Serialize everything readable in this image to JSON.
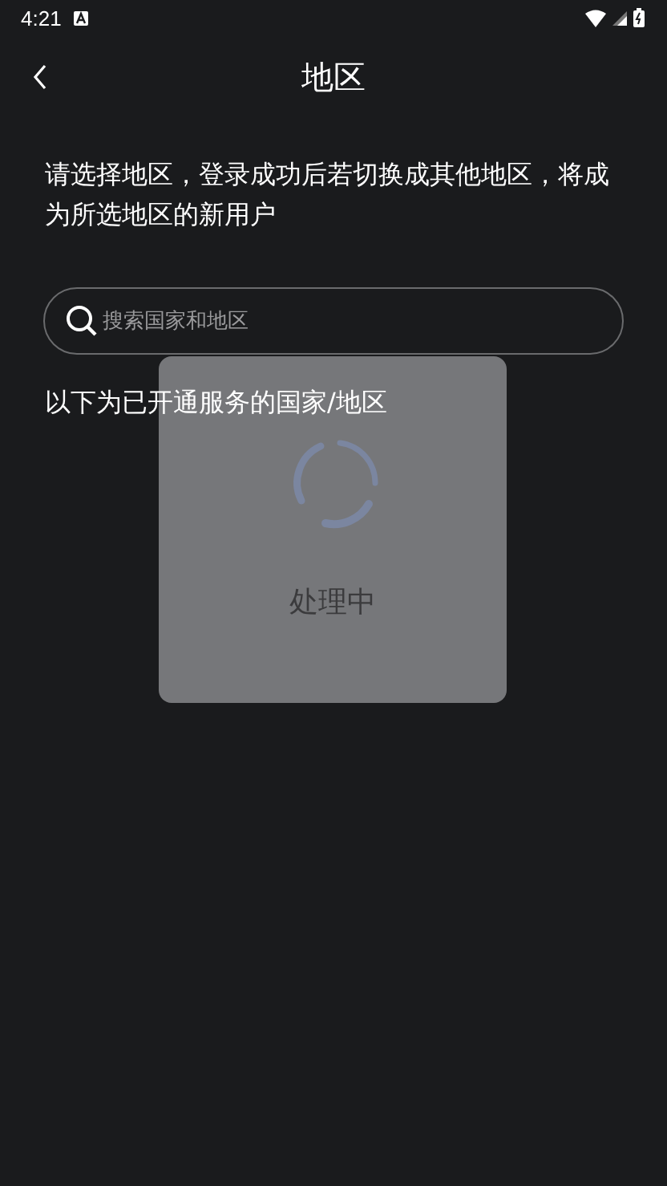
{
  "status_bar": {
    "time": "4:21"
  },
  "header": {
    "title": "地区"
  },
  "description": "请选择地区，登录成功后若切换成其他地区，将成为所选地区的新用户",
  "search": {
    "placeholder": "搜索国家和地区"
  },
  "list_heading": "以下为已开通服务的国家/地区",
  "loading_dialog": {
    "message": "处理中"
  }
}
